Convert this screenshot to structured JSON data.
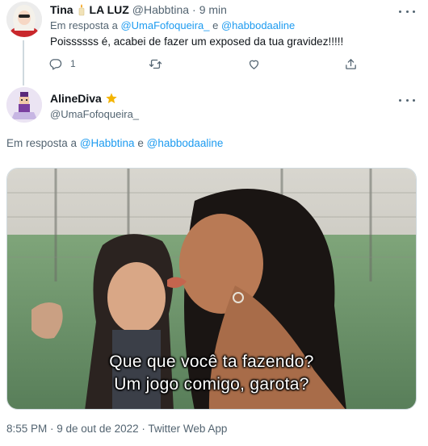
{
  "tweet1": {
    "display_name": "Tina",
    "name_suffix": "LA LUZ",
    "handle": "@Habbtina",
    "separator": "·",
    "time_ago": "9 min",
    "reply_prefix": "Em resposta a",
    "reply_user1": "@UmaFofoqueira_",
    "reply_conj": "e",
    "reply_user2": "@habbodaaline",
    "text": "Poissssss é, acabei de fazer um exposed da tua gravidez!!!!!",
    "actions": {
      "reply_icon": "reply-icon",
      "reply_count": "1",
      "retweet_icon": "retweet-icon",
      "like_icon": "heart-icon",
      "share_icon": "share-icon"
    }
  },
  "tweet2": {
    "display_name": "AlineDiva",
    "badge_icon": "star-icon",
    "handle": "@UmaFofoqueira_",
    "reply_prefix": "Em resposta a",
    "reply_user1": "@Habbtina",
    "reply_conj": "e",
    "reply_user2": "@habbodaaline",
    "media": {
      "caption_line1": "Que que você ta fazendo?",
      "caption_line2": "Um jogo comigo, garota?"
    },
    "timestamp": "8:55 PM · 9 de out de 2022 · Twitter Web App"
  },
  "colors": {
    "link": "#1d9bf0",
    "muted": "#536471",
    "text": "#0f1419",
    "star": "#f4b400"
  }
}
